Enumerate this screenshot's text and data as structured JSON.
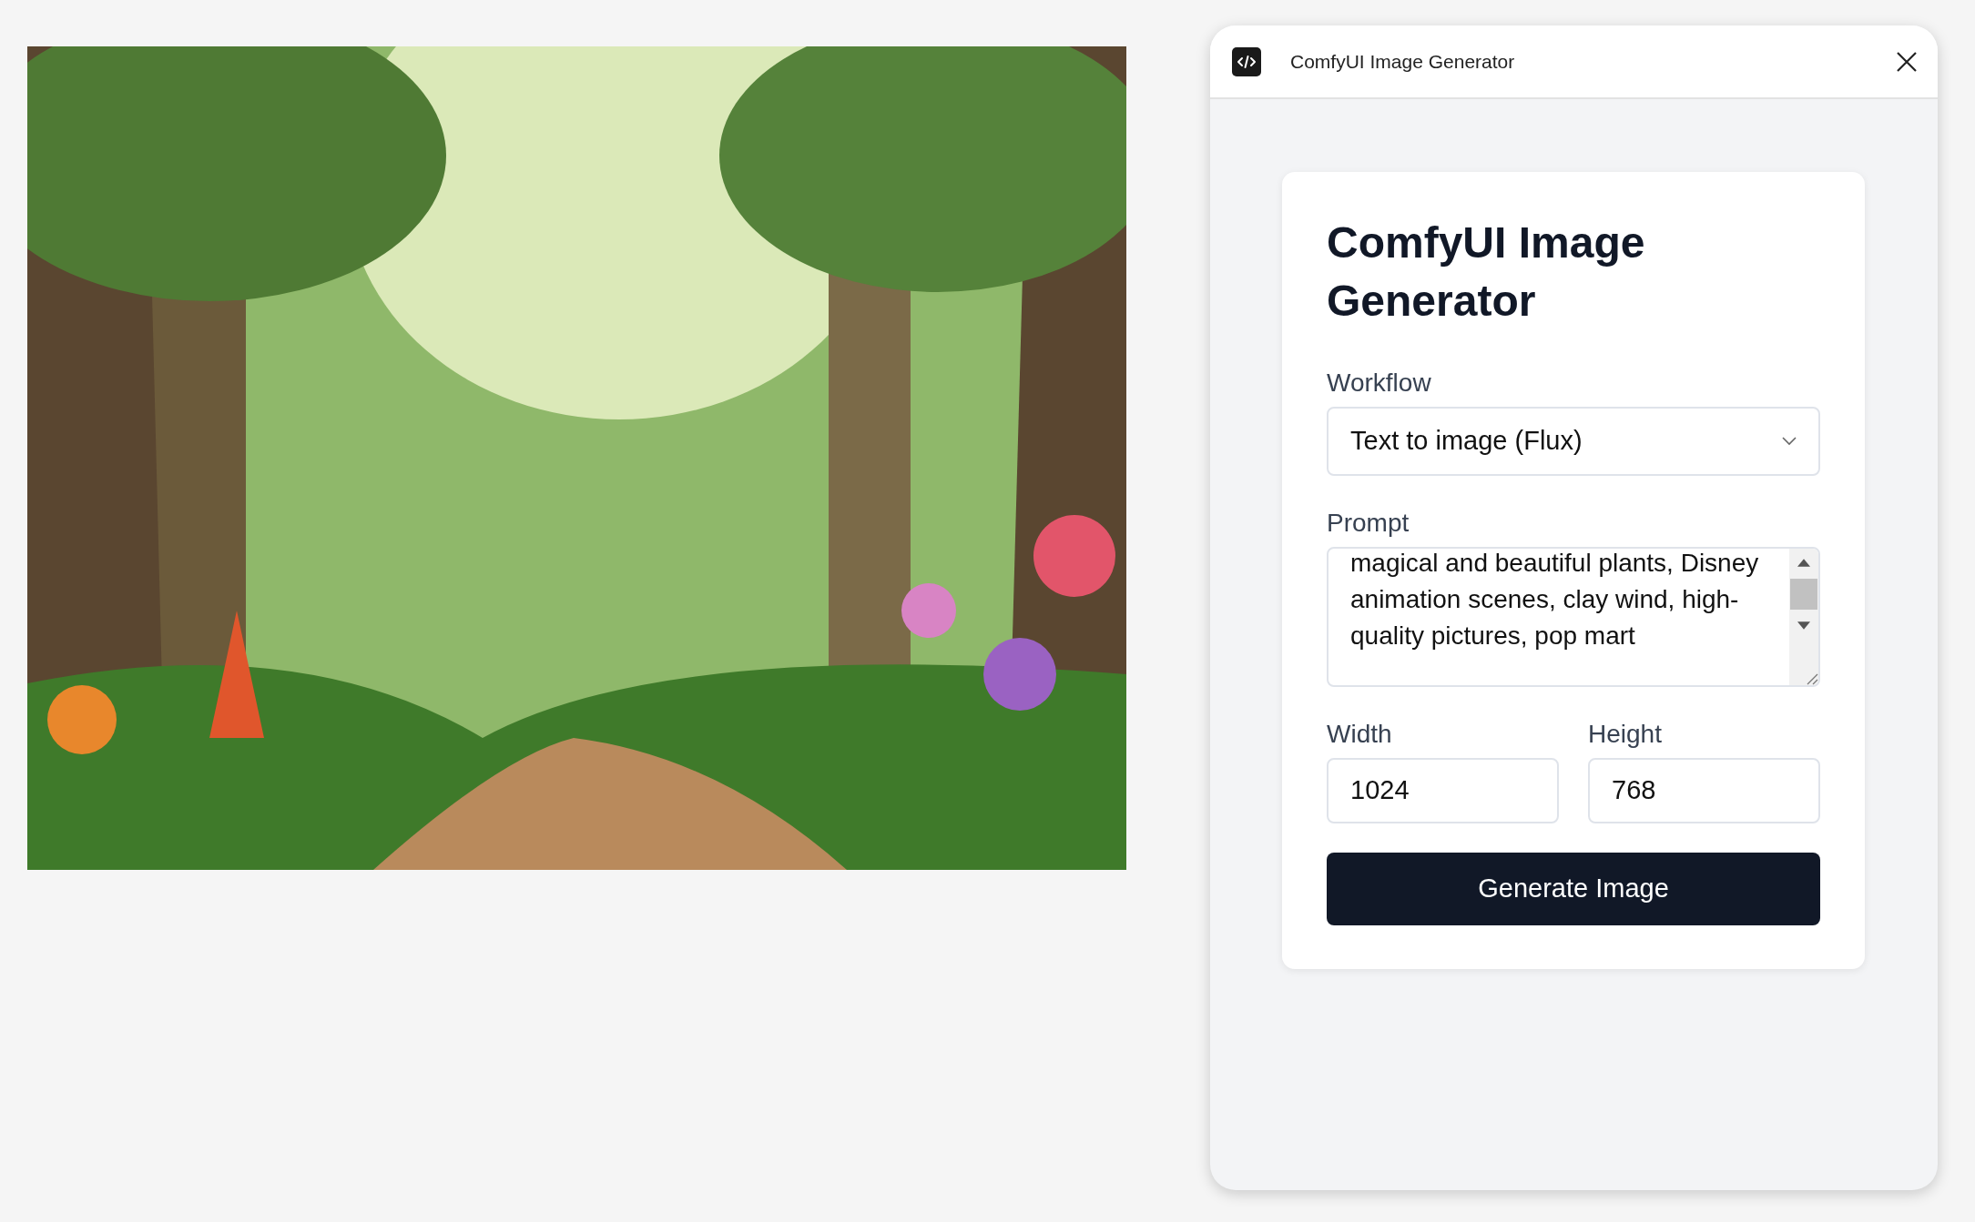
{
  "panel": {
    "title": "ComfyUI Image Generator"
  },
  "form": {
    "heading": "ComfyUI Image Generator",
    "workflow": {
      "label": "Workflow",
      "value": "Text to image (Flux)"
    },
    "prompt": {
      "label": "Prompt",
      "value": "magical and beautiful plants, Disney animation scenes, clay wind, high-quality pictures, pop mart"
    },
    "width": {
      "label": "Width",
      "value": "1024"
    },
    "height": {
      "label": "Height",
      "value": "768"
    },
    "button": "Generate Image"
  }
}
